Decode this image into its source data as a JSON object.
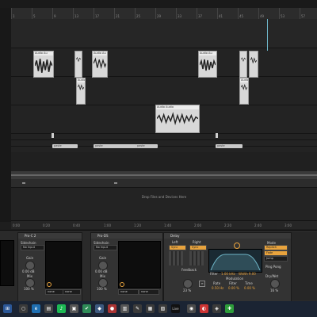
{
  "ruler": {
    "bars": [
      "1",
      "5",
      "9",
      "13",
      "17",
      "21",
      "25",
      "29",
      "33",
      "37",
      "41",
      "45",
      "49",
      "53",
      "57"
    ]
  },
  "tracks": {
    "clip_labels": {
      "audio_short": "Audio Au",
      "audio_long": "Audio Audio",
      "paste": "paste"
    },
    "drop_text": "Drop Files and Devices Here"
  },
  "timeline": {
    "labels": [
      "0:00",
      "0:20",
      "0:40",
      "1:00",
      "1:20",
      "1:40",
      "2:00",
      "2:20",
      "2:40",
      "3:00"
    ]
  },
  "devices": {
    "pro_c2": {
      "title": "Pro-C 2",
      "sidechain_label": "Sidechain",
      "sidechain_value": "No Input",
      "gain_label": "Gain",
      "gain_value": "0.00 dB",
      "mix_label": "Mix",
      "mix_value": "100 %",
      "sel_a": "none",
      "sel_b": "none"
    },
    "pro_ds": {
      "title": "Pro-DS",
      "sidechain_label": "Sidechain",
      "sidechain_value": "No Input",
      "gain_label": "Gain",
      "gain_value": "0.00 dB",
      "mix_label": "Mix",
      "mix_value": "100 %",
      "sel_a": "none",
      "sel_b": "none"
    },
    "delay": {
      "title": "Delay",
      "left_label": "Left",
      "right_label": "Right",
      "sync_label": "Sync",
      "feedback_label": "Feedback",
      "feedback_value": "23 %",
      "filter_label": "Filter",
      "filter_freq": "1.00 kHz",
      "filter_width": "Width 9.00",
      "modulation_label": "Modulation",
      "rate_label": "Rate",
      "rate_value": "0.50 Hz",
      "filter2_label": "Filter",
      "filter2_value": "0.00 %",
      "time_label": "Time",
      "time_value": "0.00 %",
      "mode_label": "Mode",
      "mode_value": "Repitch",
      "fade_label": "Fade",
      "jump_label": "Jump",
      "pingpong_label": "Ping Pong",
      "drywet_label": "Dry/Wet",
      "drywet_value": "16 %"
    }
  },
  "taskbar": {
    "live_label": "Live"
  },
  "colors": {
    "accent": "#e8a33d",
    "clip": "#d8d8d8",
    "playhead": "#6fb7c9",
    "taskbar": "#1b2433"
  }
}
